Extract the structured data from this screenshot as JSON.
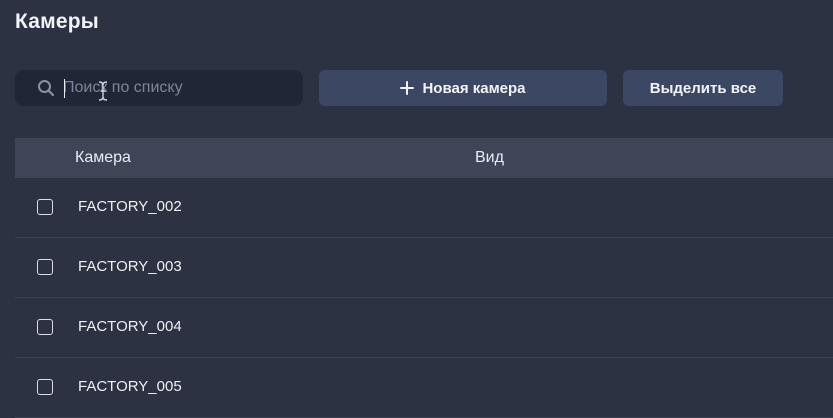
{
  "page": {
    "title": "Камеры"
  },
  "search": {
    "placeholder": "Поиск по списку",
    "value": "",
    "icon": "search-icon"
  },
  "toolbar": {
    "new_camera_label": "Новая камера",
    "new_camera_icon": "plus-icon",
    "select_all_label": "Выделить все"
  },
  "table": {
    "columns": [
      "Камера",
      "Вид"
    ],
    "rows": [
      {
        "name": "FACTORY_002",
        "view": "",
        "checked": false
      },
      {
        "name": "FACTORY_003",
        "view": "",
        "checked": false
      },
      {
        "name": "FACTORY_004",
        "view": "",
        "checked": false
      },
      {
        "name": "FACTORY_005",
        "view": "",
        "checked": false
      }
    ]
  },
  "colors": {
    "background": "#2c3242",
    "input_background": "#202636",
    "button_background": "#3c4863",
    "table_header_background": "#3e4556",
    "text": "#e9ecf2"
  }
}
